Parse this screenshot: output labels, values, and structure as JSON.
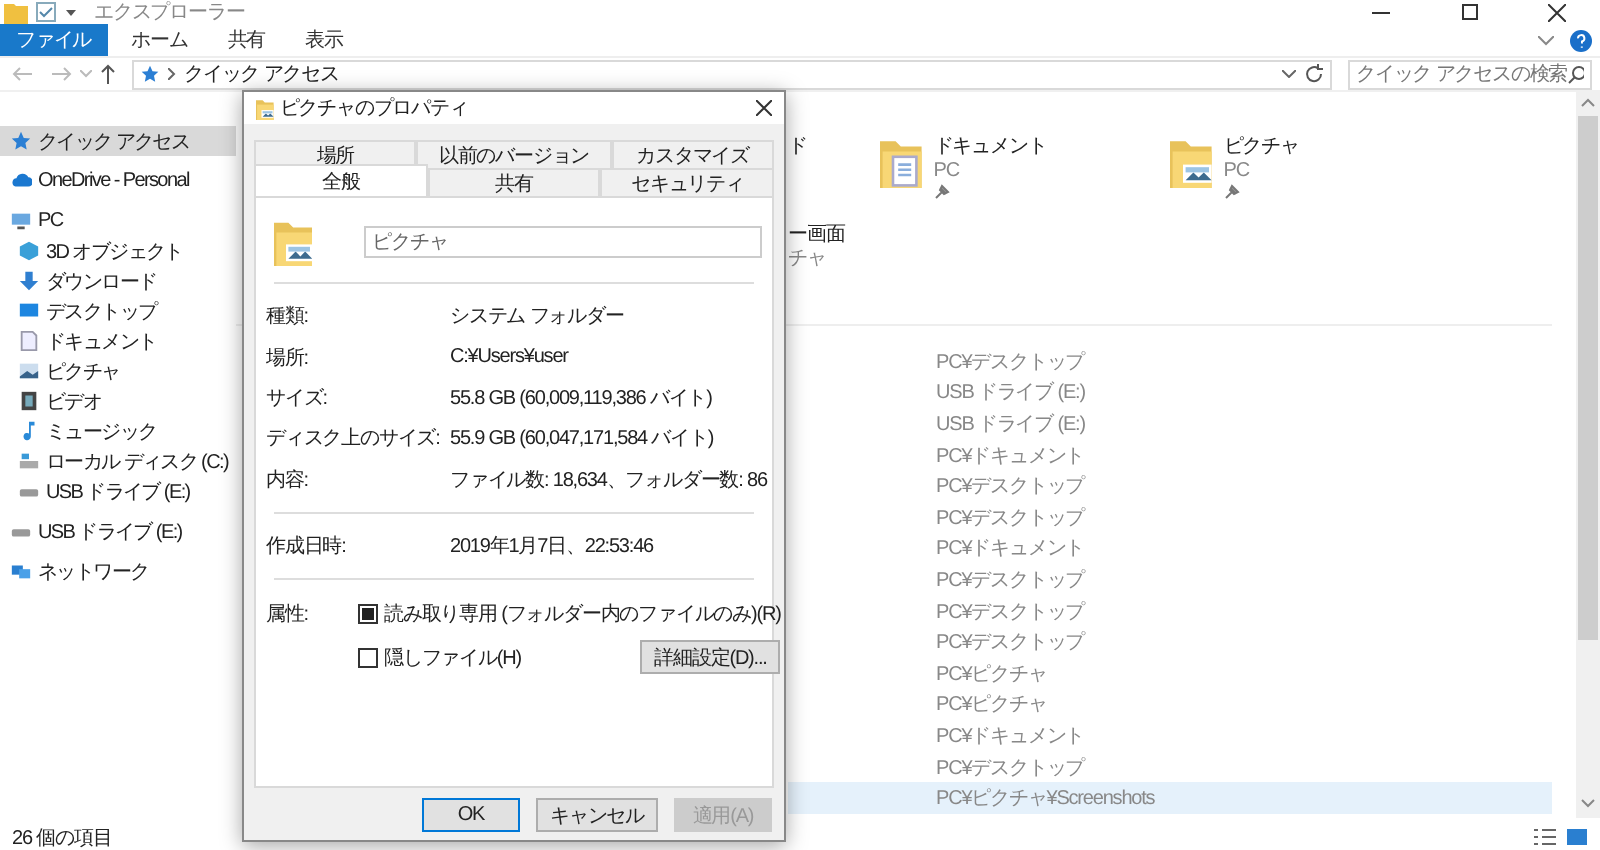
{
  "window": {
    "title": "エクスプローラー"
  },
  "ribbon_tabs": [
    {
      "label": "ファイル",
      "selected": true
    },
    {
      "label": "ホーム",
      "selected": false
    },
    {
      "label": "共有",
      "selected": false
    },
    {
      "label": "表示",
      "selected": false
    }
  ],
  "address": {
    "path": "クイック アクセス"
  },
  "search": {
    "placeholder": "クイック アクセスの検索"
  },
  "sidebar": {
    "items": [
      {
        "label": "クイック アクセス",
        "kind": "star",
        "selected": true
      },
      {
        "label": "OneDrive - Personal",
        "kind": "cloud",
        "selected": false
      },
      {
        "label": "PC",
        "kind": "pc",
        "selected": false,
        "children": [
          {
            "label": "3D オブジェクト",
            "kind": "cube",
            "selected": false
          },
          {
            "label": "ダウンロード",
            "kind": "download",
            "selected": false
          },
          {
            "label": "デスクトップ",
            "kind": "desktop",
            "selected": false
          },
          {
            "label": "ドキュメント",
            "kind": "document",
            "selected": false
          },
          {
            "label": "ピクチャ",
            "kind": "picture",
            "selected": false
          },
          {
            "label": "ビデオ",
            "kind": "video",
            "selected": false
          },
          {
            "label": "ミュージック",
            "kind": "music",
            "selected": false
          },
          {
            "label": "ローカル ディスク (C:)",
            "kind": "disk",
            "selected": false
          },
          {
            "label": "USB ドライブ (E:)",
            "kind": "usb",
            "selected": false
          }
        ]
      },
      {
        "label": "USB ドライブ (E:)",
        "kind": "usb",
        "selected": false
      },
      {
        "label": "ネットワーク",
        "kind": "network",
        "selected": false
      }
    ]
  },
  "frequent_folders": [
    {
      "name": "ド"
    },
    {
      "name": "ドキュメント",
      "location": "PC",
      "kind": "documents",
      "pinned": true
    },
    {
      "name": "ピクチャ",
      "location": "PC",
      "kind": "pictures",
      "pinned": true
    },
    {
      "name": "ー画面",
      "location": "チャ"
    }
  ],
  "recent_files": [
    {
      "location": "PC¥デスクトップ",
      "selected": false
    },
    {
      "location": "USB ドライブ (E:)",
      "selected": false
    },
    {
      "location": "USB ドライブ (E:)",
      "selected": false
    },
    {
      "location": "PC¥ドキュメント",
      "selected": false
    },
    {
      "location": "PC¥デスクトップ",
      "selected": false
    },
    {
      "location": "PC¥デスクトップ",
      "selected": false
    },
    {
      "location": "PC¥ドキュメント",
      "selected": false
    },
    {
      "location": "PC¥デスクトップ",
      "selected": false
    },
    {
      "location": "PC¥デスクトップ",
      "selected": false
    },
    {
      "location": "PC¥デスクトップ",
      "selected": false
    },
    {
      "location": "PC¥ピクチャ",
      "selected": false
    },
    {
      "location": "PC¥ピクチャ",
      "selected": false
    },
    {
      "location": "PC¥ドキュメント",
      "selected": false
    },
    {
      "location": "PC¥デスクトップ",
      "selected": false
    },
    {
      "location": "PC¥ピクチャ¥Screenshots",
      "selected": true
    }
  ],
  "status_bar": {
    "count": "26 個の項目"
  },
  "dialog": {
    "title": "ピクチャのプロパティ",
    "tab_rows": [
      [
        {
          "label": "場所",
          "selected": false
        },
        {
          "label": "以前のバージョン",
          "selected": false
        },
        {
          "label": "カスタマイズ",
          "selected": false
        }
      ],
      [
        {
          "label": "全般",
          "selected": true
        },
        {
          "label": "共有",
          "selected": false
        },
        {
          "label": "セキュリティ",
          "selected": false
        }
      ]
    ],
    "name_field": {
      "value": "ピクチャ"
    },
    "sections": [
      [
        {
          "label": "種類:",
          "value": "システム フォルダー"
        },
        {
          "label": "場所:",
          "value": "C:¥Users¥user"
        },
        {
          "label": "サイズ:",
          "value": "55.8 GB (60,009,119,386 バイト)"
        },
        {
          "label": "ディスク上のサイズ:",
          "value": "55.9 GB (60,047,171,584 バイト)"
        },
        {
          "label": "内容:",
          "value": "ファイル数: 18,634、フォルダー数: 86"
        }
      ],
      [
        {
          "label": "作成日時:",
          "value": "2019年1月7日、22:53:46"
        }
      ]
    ],
    "attributes": {
      "label": "属性:",
      "options": [
        {
          "label": "読み取り専用 (フォルダー内のファイルのみ)(R)",
          "checked": false,
          "indeterminate": true
        },
        {
          "label": "隠しファイル(H)",
          "checked": false,
          "indeterminate": false
        }
      ],
      "advanced_button": "詳細設定(D)..."
    },
    "buttons": [
      {
        "label": "OK",
        "default": true,
        "disabled": false
      },
      {
        "label": "キャンセル",
        "default": false,
        "disabled": false
      },
      {
        "label": "適用(A)",
        "default": false,
        "disabled": true
      }
    ]
  }
}
